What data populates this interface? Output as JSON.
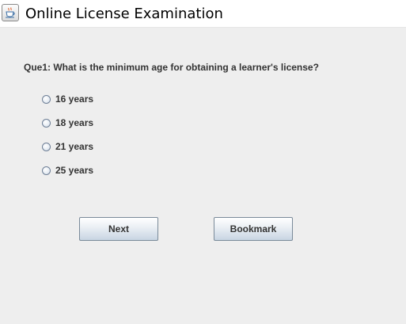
{
  "window": {
    "title": "Online License Examination",
    "icon": "java-cup-icon"
  },
  "question": {
    "text": "Que1: What is the minimum age for obtaining a learner's license?",
    "options": [
      {
        "label": "16 years",
        "selected": false
      },
      {
        "label": "18 years",
        "selected": false
      },
      {
        "label": "21 years",
        "selected": false
      },
      {
        "label": "25 years",
        "selected": false
      }
    ]
  },
  "buttons": {
    "next_label": "Next",
    "bookmark_label": "Bookmark"
  },
  "colors": {
    "background": "#eeeeee",
    "titlebar": "#ffffff",
    "text": "#333333",
    "button_border": "#7a8a99"
  }
}
